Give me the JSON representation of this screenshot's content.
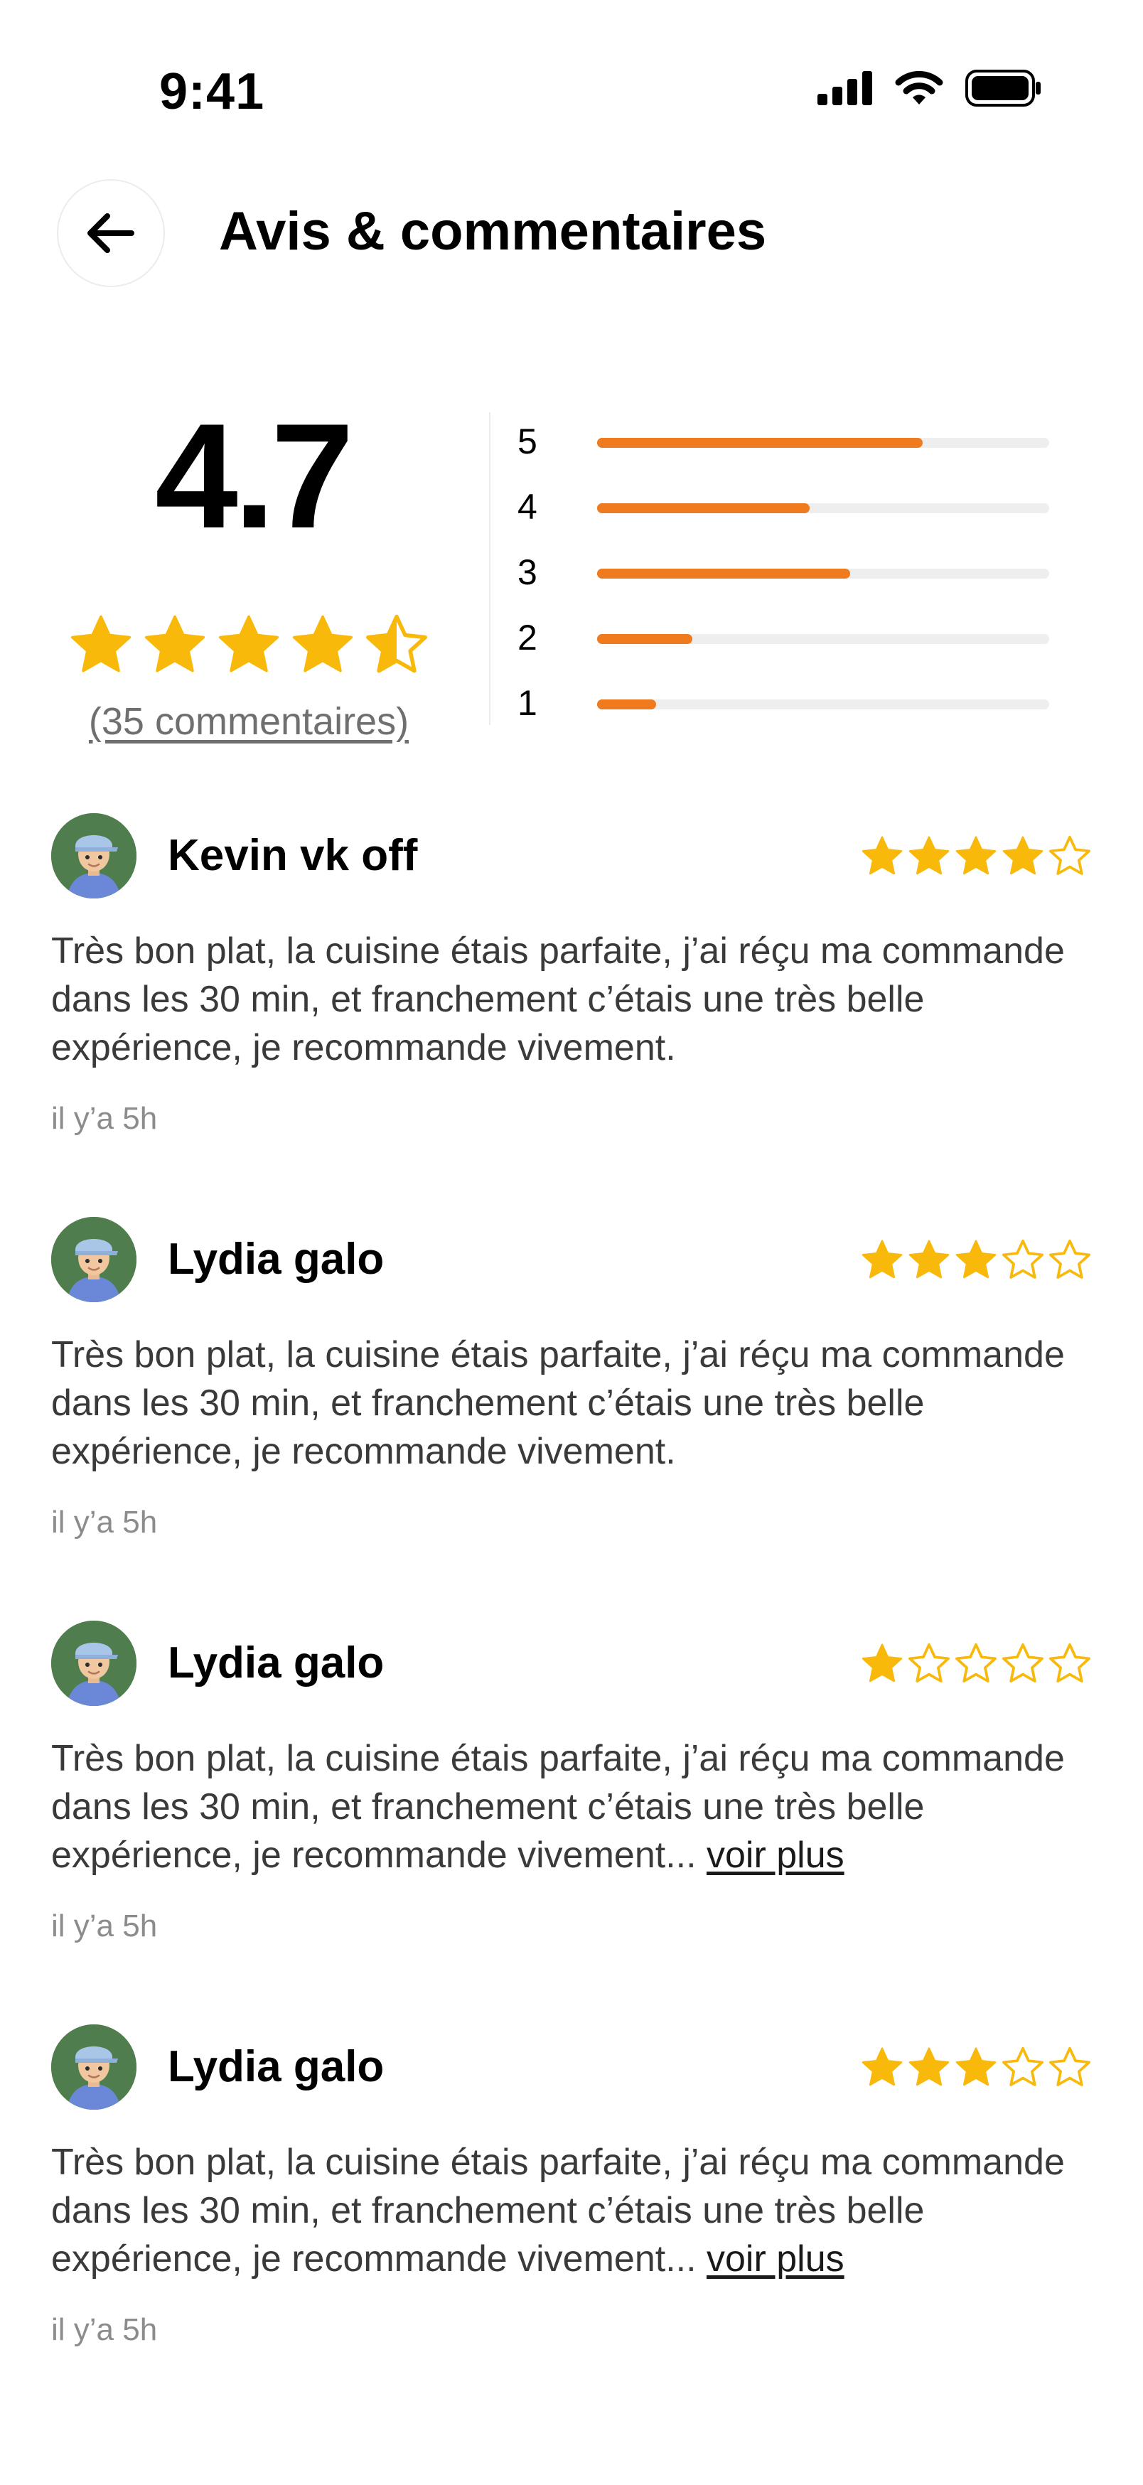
{
  "status_bar": {
    "time": "9:41"
  },
  "header": {
    "title": "Avis & commentaires"
  },
  "summary": {
    "average": "4.7",
    "average_stars": 4.7,
    "review_count_label": "(35 commentaires)",
    "distribution": [
      {
        "label": "5",
        "fraction": 0.72
      },
      {
        "label": "4",
        "fraction": 0.47
      },
      {
        "label": "3",
        "fraction": 0.56
      },
      {
        "label": "2",
        "fraction": 0.21
      },
      {
        "label": "1",
        "fraction": 0.13
      }
    ]
  },
  "colors": {
    "star": "#f9b90b",
    "bar": "#f07a1e",
    "track": "#eeeeee"
  },
  "reviews": [
    {
      "name": "Kevin vk off",
      "rating": 4,
      "text": "Très bon plat, la cuisine étais parfaite, j’ai réçu ma commande dans les 30 min, et franchement c’étais une très belle expérience, je recommande vivement.",
      "more_label": "",
      "time": "il y’a 5h"
    },
    {
      "name": "Lydia galo",
      "rating": 3,
      "text": "Très bon plat, la cuisine étais parfaite, j’ai réçu ma commande dans les 30 min, et franchement c’étais une très belle expérience, je recommande vivement.",
      "more_label": "",
      "time": "il y’a 5h"
    },
    {
      "name": "Lydia galo",
      "rating": 1,
      "text": "Très bon plat, la cuisine étais parfaite, j’ai réçu ma commande dans les 30 min, et franchement c’étais une très belle expérience, je recommande vivement...",
      "more_label": "voir plus",
      "time": "il y’a 5h"
    },
    {
      "name": "Lydia galo",
      "rating": 3,
      "text": "Très bon plat, la cuisine étais parfaite, j’ai réçu ma commande dans les 30 min, et franchement c’étais une très belle expérience, je recommande vivement...",
      "more_label": "voir plus",
      "time": "il y’a 5h"
    }
  ]
}
